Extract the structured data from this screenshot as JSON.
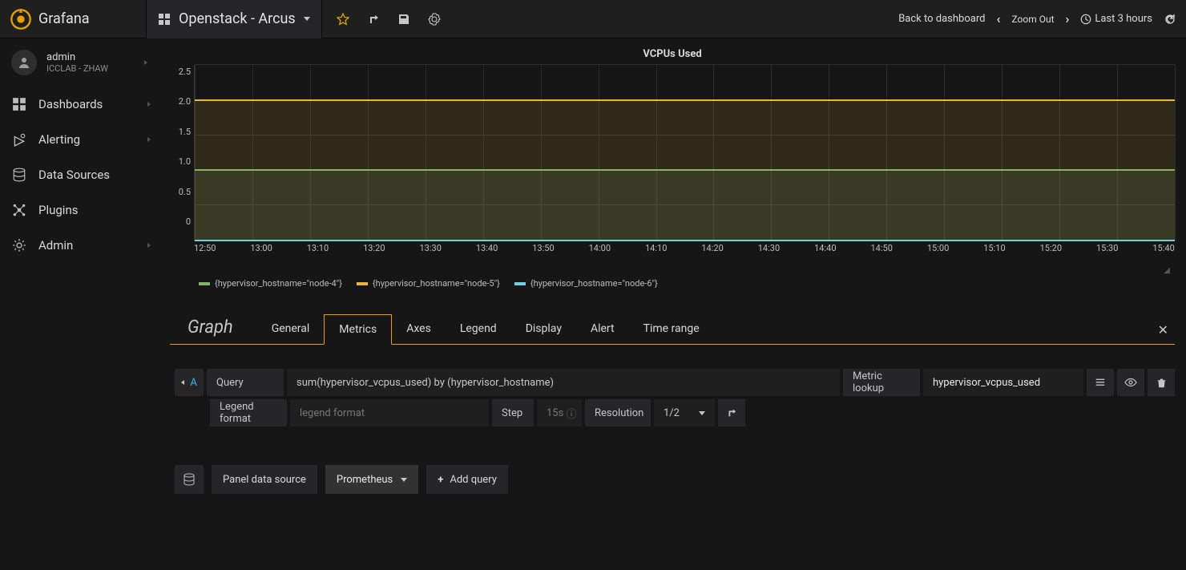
{
  "brand": "Grafana",
  "dashboard_title": "Openstack - Arcus",
  "topbar_right": {
    "back": "Back to dashboard",
    "zoom_out": "Zoom Out",
    "timerange": "Last 3 hours"
  },
  "user": {
    "name": "admin",
    "org": "ICCLAB - ZHAW"
  },
  "sidebar": {
    "items": [
      {
        "label": "Dashboards"
      },
      {
        "label": "Alerting"
      },
      {
        "label": "Data Sources"
      },
      {
        "label": "Plugins"
      },
      {
        "label": "Admin"
      }
    ]
  },
  "panel": {
    "title": "VCPUs Used",
    "y_ticks": [
      "2.5",
      "2.0",
      "1.5",
      "1.0",
      "0.5",
      "0"
    ],
    "x_ticks": [
      "12:50",
      "13:00",
      "13:10",
      "13:20",
      "13:30",
      "13:40",
      "13:50",
      "14:00",
      "14:10",
      "14:20",
      "14:30",
      "14:40",
      "14:50",
      "15:00",
      "15:10",
      "15:20",
      "15:30",
      "15:40"
    ],
    "legend": [
      {
        "label": "{hypervisor_hostname=\"node-4\"}",
        "color": "#7eb26d"
      },
      {
        "label": "{hypervisor_hostname=\"node-5\"}",
        "color": "#eab839"
      },
      {
        "label": "{hypervisor_hostname=\"node-6\"}",
        "color": "#6ed0e0"
      }
    ]
  },
  "editor": {
    "title": "Graph",
    "tabs": [
      "General",
      "Metrics",
      "Axes",
      "Legend",
      "Display",
      "Alert",
      "Time range"
    ],
    "active_tab": "Metrics",
    "query_letter": "A",
    "labels": {
      "query": "Query",
      "metric_lookup": "Metric lookup",
      "legend_format": "Legend format",
      "legend_placeholder": "legend format",
      "step": "Step",
      "step_placeholder": "15s",
      "resolution": "Resolution",
      "resolution_value": "1/2",
      "panel_ds": "Panel data source",
      "ds_value": "Prometheus",
      "add_query": "Add query"
    },
    "query_value": "sum(hypervisor_vcpus_used) by (hypervisor_hostname)",
    "metric_lookup_value": "hypervisor_vcpus_used"
  },
  "colors": {
    "accent": "#e6a100"
  },
  "chart_data": {
    "type": "line",
    "title": "VCPUs Used",
    "xlabel": "",
    "ylabel": "",
    "ylim": [
      0,
      2.5
    ],
    "x": [
      "12:50",
      "13:00",
      "13:10",
      "13:20",
      "13:30",
      "13:40",
      "13:50",
      "14:00",
      "14:10",
      "14:20",
      "14:30",
      "14:40",
      "14:50",
      "15:00",
      "15:10",
      "15:20",
      "15:30",
      "15:40"
    ],
    "series": [
      {
        "name": "{hypervisor_hostname=\"node-4\"}",
        "color": "#7eb26d",
        "values": [
          1,
          1,
          1,
          1,
          1,
          1,
          1,
          1,
          1,
          1,
          1,
          1,
          1,
          1,
          1,
          1,
          1,
          1
        ]
      },
      {
        "name": "{hypervisor_hostname=\"node-5\"}",
        "color": "#eab839",
        "values": [
          2,
          2,
          2,
          2,
          2,
          2,
          2,
          2,
          2,
          2,
          2,
          2,
          2,
          2,
          2,
          2,
          2,
          2
        ]
      },
      {
        "name": "{hypervisor_hostname=\"node-6\"}",
        "color": "#6ed0e0",
        "values": [
          0,
          0,
          0,
          0,
          0,
          0,
          0,
          0,
          0,
          0,
          0,
          0,
          0,
          0,
          0,
          0,
          0,
          0
        ]
      }
    ]
  }
}
